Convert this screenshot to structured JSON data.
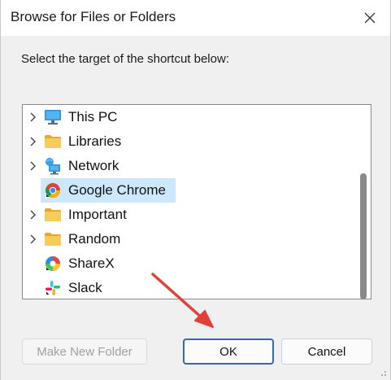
{
  "window": {
    "title": "Browse for Files or Folders",
    "close_icon": "close-icon"
  },
  "prompt": "Select the target of the shortcut below:",
  "tree": {
    "items": [
      {
        "label": "This PC",
        "icon": "computer-icon",
        "expandable": true,
        "selected": false
      },
      {
        "label": "Libraries",
        "icon": "folder-icon",
        "expandable": true,
        "selected": false
      },
      {
        "label": "Network",
        "icon": "network-icon",
        "expandable": true,
        "selected": false
      },
      {
        "label": "Google Chrome",
        "icon": "chrome-icon",
        "expandable": false,
        "selected": true
      },
      {
        "label": "Important",
        "icon": "folder-icon",
        "expandable": true,
        "selected": false
      },
      {
        "label": "Random",
        "icon": "folder-icon",
        "expandable": true,
        "selected": false
      },
      {
        "label": "ShareX",
        "icon": "sharex-icon",
        "expandable": false,
        "selected": false
      },
      {
        "label": "Slack",
        "icon": "slack-icon",
        "expandable": false,
        "selected": false
      }
    ]
  },
  "buttons": {
    "make_new_folder": "Make New Folder",
    "ok": "OK",
    "cancel": "Cancel"
  },
  "colors": {
    "selection": "#cce8ff",
    "ok_border": "#2f6cb8",
    "annotation_arrow": "#e0413a",
    "folder": "#f5c242"
  }
}
